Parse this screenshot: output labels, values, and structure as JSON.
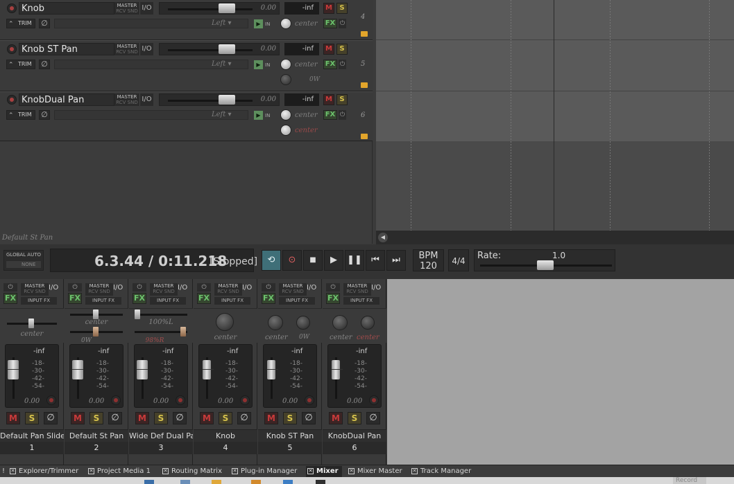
{
  "tracks": [
    {
      "name": "Knob",
      "num": "4",
      "master": "MASTER",
      "rcv": "RCV SND",
      "io": "I/O",
      "volume": "0.00",
      "peak": "-inf",
      "mute": "M",
      "solo": "S",
      "trim": "TRIM",
      "pan_mode": "Left",
      "in": "IN",
      "pan": "center",
      "pan2": ""
    },
    {
      "name": "Knob ST Pan",
      "num": "5",
      "master": "MASTER",
      "rcv": "RCV SND",
      "io": "I/O",
      "volume": "0.00",
      "peak": "-inf",
      "mute": "M",
      "solo": "S",
      "trim": "TRIM",
      "pan_mode": "Left",
      "in": "IN",
      "pan": "center",
      "pan2": "0W"
    },
    {
      "name": "KnobDual Pan",
      "num": "6",
      "master": "MASTER",
      "rcv": "RCV SND",
      "io": "I/O",
      "volume": "0.00",
      "peak": "-inf",
      "mute": "M",
      "solo": "S",
      "trim": "TRIM",
      "pan_mode": "Left",
      "in": "IN",
      "pan": "center",
      "pan2": "center"
    }
  ],
  "fx_label": "FX",
  "status_line": "Default St Pan",
  "global_auto": {
    "title": "GLOBAL AUTO",
    "mode": "NONE"
  },
  "transport": {
    "position": "6.3.44 / 0:11.218",
    "state": "[Stopped]"
  },
  "bpm": {
    "label": "BPM",
    "value": "120"
  },
  "time_sig": "4/4",
  "rate": {
    "label": "Rate:",
    "value": "1.0"
  },
  "mixer": {
    "input_fx": "INPUT FX",
    "master": "MASTER",
    "rcv": "RCV SND",
    "io": "I/O",
    "peak": "-inf",
    "scale": [
      "-18-",
      "-30-",
      "-42-",
      "-54-"
    ],
    "strips": [
      {
        "name": "Default Pan Slider",
        "num": "1",
        "volume": "0.00",
        "pan": "center",
        "pan2": ""
      },
      {
        "name": "Default St Pan",
        "num": "2",
        "volume": "0.00",
        "pan": "center",
        "pan2": "0W"
      },
      {
        "name": "Wide Def Dual Pan",
        "num": "3",
        "volume": "0.00",
        "pan": "100%L",
        "pan2": "98%R"
      },
      {
        "name": "Knob",
        "num": "4",
        "volume": "0.00",
        "pan": "center",
        "pan2": ""
      },
      {
        "name": "Knob ST Pan",
        "num": "5",
        "volume": "0.00",
        "pan": "center",
        "pan2": "0W"
      },
      {
        "name": "KnobDual Pan",
        "num": "6",
        "volume": "0.00",
        "pan": "center",
        "pan2": "center"
      }
    ]
  },
  "tabs": [
    "Explorer/Trimmer",
    "Project Media 1",
    "Routing Matrix",
    "Plug-in Manager",
    "Mixer",
    "Mixer Master",
    "Track Manager"
  ],
  "active_tab": "Mixer",
  "taskbar": {
    "record": "Record"
  },
  "colors": {
    "mute": "#c83a3a",
    "solo": "#d6c24c",
    "fx": "#6cc26c",
    "folder": "#e2a52b",
    "arrange": "#5a5a5a"
  }
}
